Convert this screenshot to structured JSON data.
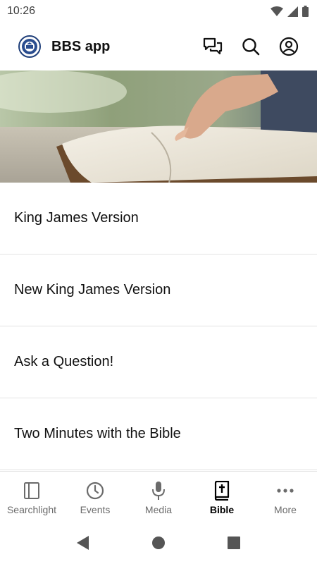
{
  "status_bar": {
    "time": "10:26",
    "icons": [
      "wifi-icon",
      "signal-icon",
      "battery-icon"
    ]
  },
  "app_bar": {
    "title": "BBS app",
    "logo_icon": "bbs-logo",
    "actions": [
      "chat-icon",
      "search-icon",
      "account-icon"
    ]
  },
  "hero": {
    "image": "hand-on-open-bible"
  },
  "list": [
    {
      "label": "King James Version"
    },
    {
      "label": "New King James Version"
    },
    {
      "label": "Ask a Question!"
    },
    {
      "label": "Two Minutes with the Bible"
    }
  ],
  "bottom_nav": {
    "items": [
      {
        "label": "Searchlight",
        "icon": "book-outline-icon"
      },
      {
        "label": "Events",
        "icon": "clock-icon"
      },
      {
        "label": "Media",
        "icon": "microphone-icon"
      },
      {
        "label": "Bible",
        "icon": "bible-icon",
        "active": true
      },
      {
        "label": "More",
        "icon": "more-dots-icon"
      }
    ],
    "active_color": "#000000",
    "inactive_color": "#6b6b6b"
  },
  "system_nav": [
    "back-icon",
    "home-icon",
    "recents-icon"
  ]
}
